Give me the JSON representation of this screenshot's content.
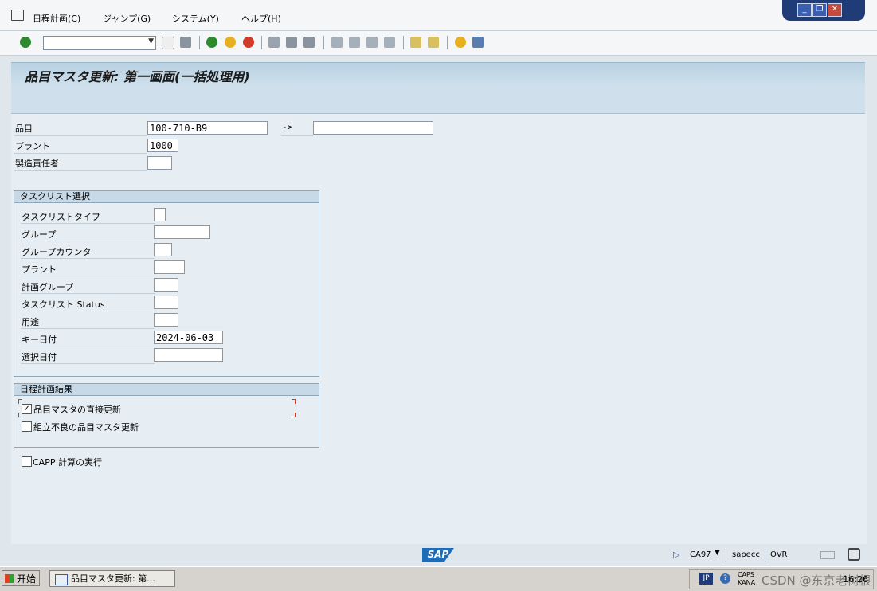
{
  "menubar": {
    "items": [
      {
        "label": "日程計画(C)"
      },
      {
        "label": "ジャンプ(G)"
      },
      {
        "label": "システム(Y)"
      },
      {
        "label": "ヘルプ(H)"
      }
    ]
  },
  "window_controls": {
    "min": "_",
    "restore": "❐",
    "close": "✕"
  },
  "toolbar": {
    "command_value": "",
    "dropdown": "▼"
  },
  "page": {
    "title": "品目マスタ更新: 第一画面(一括処理用)"
  },
  "selection": {
    "material_label": "品目",
    "material_value": "100-710-B9",
    "arrow": "->",
    "material_to_value": "",
    "plant_label": "プラント",
    "plant_value": "1000",
    "mrp_controller_label": "製造責任者",
    "mrp_controller_value": ""
  },
  "tasklist": {
    "title": "タスクリスト選択",
    "fields": [
      {
        "label": "タスクリストタイプ",
        "value": ""
      },
      {
        "label": "グループ",
        "value": ""
      },
      {
        "label": "グループカウンタ",
        "value": ""
      },
      {
        "label": "プラント",
        "value": ""
      },
      {
        "label": "計画グループ",
        "value": ""
      },
      {
        "label": "タスクリスト Status",
        "value": ""
      },
      {
        "label": "用途",
        "value": ""
      },
      {
        "label": "キー日付",
        "value": "2024-06-03"
      },
      {
        "label": "選択日付",
        "value": ""
      }
    ]
  },
  "results": {
    "title": "日程計画結果",
    "opt1_label": "品目マスタの直接更新",
    "opt1_checked": "✓",
    "opt2_label": "組立不良の品目マスタ更新",
    "opt2_checked": ""
  },
  "capp": {
    "label": "CAPP 計算の実行",
    "checked": ""
  },
  "statusbar": {
    "logo": "SAP",
    "system": "CA97",
    "server": "sapecc",
    "mode": "OVR"
  },
  "taskbar": {
    "start": "开始",
    "task": "品目マスタ更新: 第...",
    "lang": "JP",
    "caps": "CAPS",
    "kana": "KANA",
    "clock": "16:26",
    "watermark": "CSDN @东京老树根"
  },
  "colors": {
    "accent": "#1f3c78",
    "title_bg": "#b9d1e3",
    "content_bg": "#e6eef3"
  }
}
